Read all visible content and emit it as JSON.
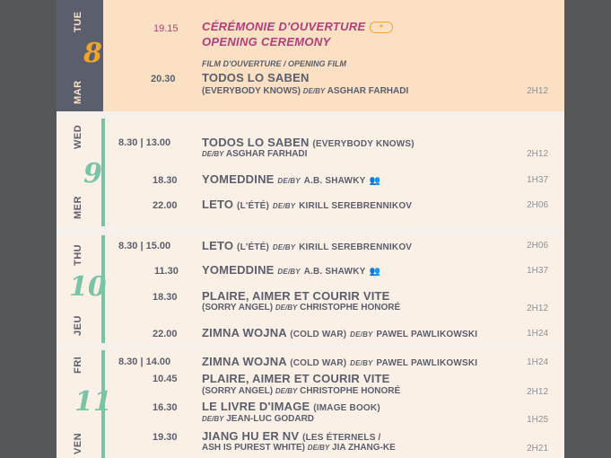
{
  "days": [
    {
      "dow_en": "TUE",
      "dow_fr": "MAR",
      "num": "8"
    },
    {
      "dow_en": "WED",
      "dow_fr": "MER",
      "num": "9"
    },
    {
      "dow_en": "THU",
      "dow_fr": "JEU",
      "num": "10"
    },
    {
      "dow_en": "FRI",
      "dow_fr": "VEN",
      "num": "11"
    }
  ],
  "d8": {
    "ceremony_time": "19.15",
    "ceremony_fr": "CÉRÉMONIE D'OUVERTURE",
    "ceremony_en": "OPENING CEREMONY",
    "film_tag": "FILM D'OUVERTURE / OPENING FILM",
    "film_time": "20.30",
    "film_title": "TODOS LO SABEN",
    "film_sub": "(EVERYBODY KNOWS)",
    "film_by": "DE/BY",
    "film_director": "ASGHAR FARHADI",
    "film_dur": "2H12"
  },
  "d9": [
    {
      "time": "8.30 | 13.00",
      "title": "TODOS LO SABEN",
      "alt": "(EVERYBODY KNOWS)",
      "by": "DE/BY",
      "director": "ASGHAR FARHADI",
      "dur": "2H12"
    },
    {
      "time": "18.30",
      "title": "YOMEDDINE",
      "by": "DE/BY",
      "director": "A.B. SHAWKY",
      "dur": "1H37"
    },
    {
      "time": "22.00",
      "title": "LETO",
      "alt": "(L'ÉTÉ)",
      "by": "DE/BY",
      "director": "KIRILL SEREBRENNIKOV",
      "dur": "2H06"
    }
  ],
  "d10": [
    {
      "time": "8.30 | 15.00",
      "title": "LETO",
      "alt": "(L'ÉTÉ)",
      "by": "DE/BY",
      "director": "KIRILL SEREBRENNIKOV",
      "dur": "2H06"
    },
    {
      "time": "11.30",
      "title": "YOMEDDINE",
      "by": "DE/BY",
      "director": "A.B. SHAWKY",
      "dur": "1H37"
    },
    {
      "time": "18.30",
      "title": "PLAIRE, AIMER ET COURIR VITE",
      "alt": "(SORRY ANGEL)",
      "by": "DE/BY",
      "director": "CHRISTOPHE HONORÉ",
      "dur": "2H12"
    },
    {
      "time": "22.00",
      "title": "ZIMNA WOJNA",
      "alt": "(COLD WAR)",
      "by": "DE/BY",
      "director": "PAWEL PAWLIKOWSKI",
      "dur": "1H24"
    }
  ],
  "d11": [
    {
      "time": "8.30 | 14.00",
      "title": "ZIMNA WOJNA",
      "alt": "(COLD WAR)",
      "by": "DE/BY",
      "director": "PAWEL PAWLIKOWSKI",
      "dur": "1H24"
    },
    {
      "time": "10.45",
      "title": "PLAIRE, AIMER ET COURIR VITE",
      "alt": "(SORRY ANGEL)",
      "by": "DE/BY",
      "director": "CHRISTOPHE HONORÉ",
      "dur": "2H12"
    },
    {
      "time": "16.30",
      "title": "LE LIVRE D'IMAGE",
      "alt": "(IMAGE BOOK)",
      "by": "DE/BY",
      "director": "JEAN-LUC GODARD",
      "dur": "1H25"
    },
    {
      "time": "19.30",
      "title": "JIANG HU ER NV",
      "alt": "(LES ÉTERNELS /",
      "alt2": "ASH IS PUREST WHITE)",
      "by": "DE/BY",
      "director": "JIA ZHANG-KE",
      "dur": "2H21"
    }
  ]
}
